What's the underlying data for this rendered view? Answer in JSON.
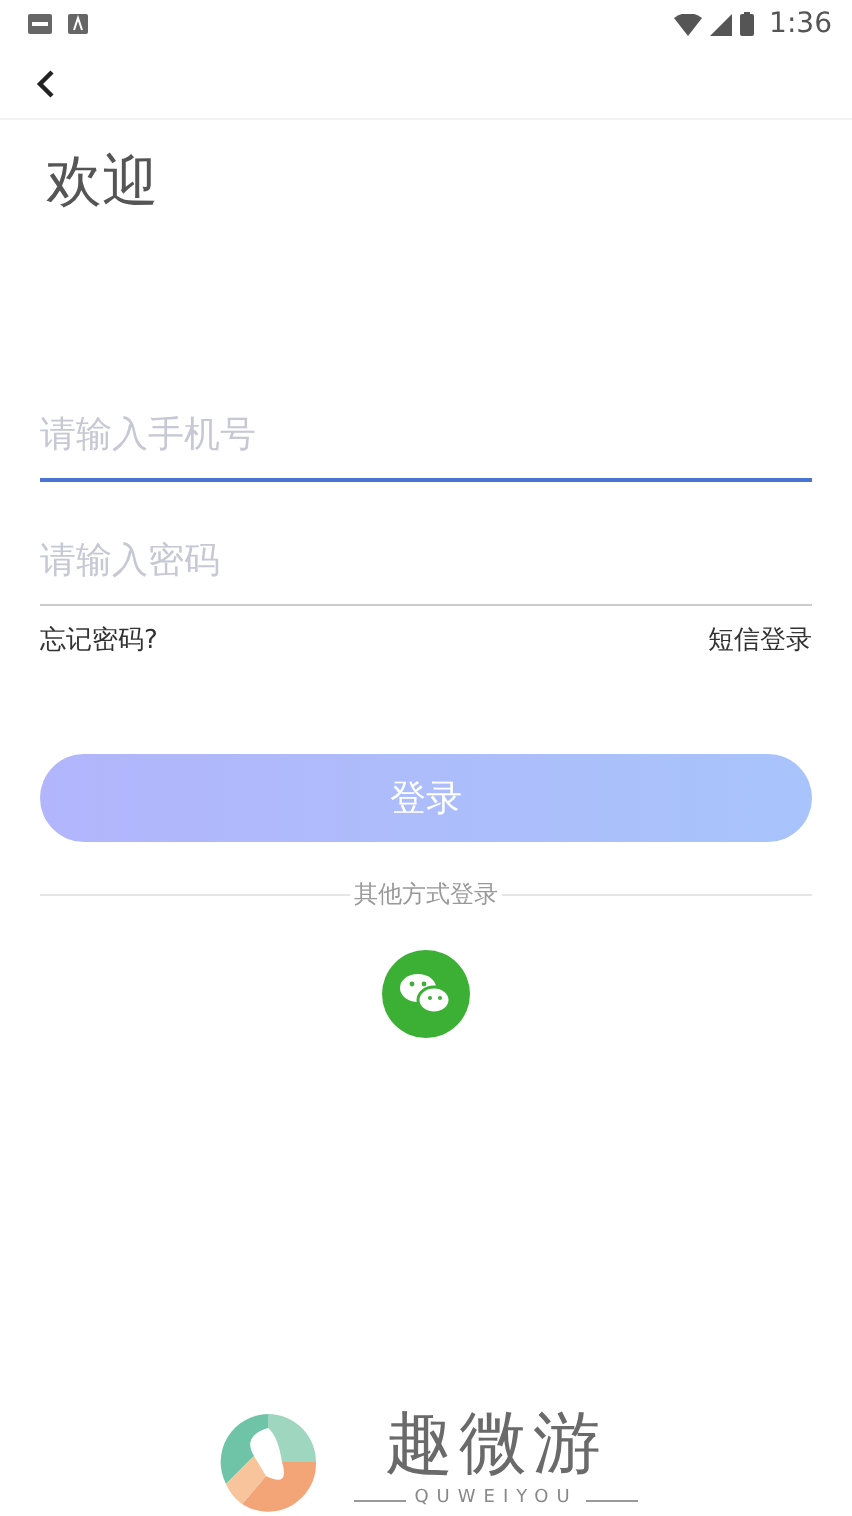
{
  "status_bar": {
    "time": "1:36"
  },
  "title": "欢迎",
  "fields": [
    {
      "placeholder": "请输入手机号",
      "focused": true
    },
    {
      "placeholder": "请输入密码",
      "focused": false
    }
  ],
  "links": [
    "忘记密码?",
    "短信登录"
  ],
  "login_button": "登录",
  "divider_label": "其他方式登录",
  "brand": {
    "name": "趣微游",
    "tagline": "QUWEIYOU"
  }
}
